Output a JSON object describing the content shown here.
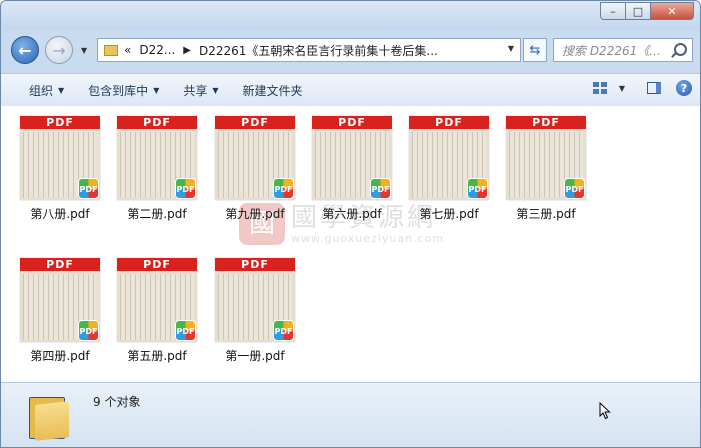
{
  "titlebar": {
    "minimize": "–",
    "maximize": "□",
    "close": "✕"
  },
  "nav": {
    "back_icon": "back-arrow-icon",
    "forward_icon": "forward-arrow-icon"
  },
  "address": {
    "overflow": "«",
    "crumb1": "D22...",
    "crumb2": "D22261《五朝宋名臣言行录前集十卷后集..."
  },
  "search": {
    "placeholder": "搜索 D22261《..."
  },
  "toolbar": {
    "organize": "组织",
    "include_library": "包含到库中",
    "share": "共享",
    "new_folder": "新建文件夹"
  },
  "files": [
    {
      "name": "第八册.pdf"
    },
    {
      "name": "第二册.pdf"
    },
    {
      "name": "第九册.pdf"
    },
    {
      "name": "第六册.pdf"
    },
    {
      "name": "第七册.pdf"
    },
    {
      "name": "第三册.pdf"
    },
    {
      "name": "第四册.pdf"
    },
    {
      "name": "第五册.pdf"
    },
    {
      "name": "第一册.pdf"
    }
  ],
  "thumb": {
    "header": "PDF",
    "badge": "PDF"
  },
  "watermark": {
    "seal": "國",
    "name": "國學資源網",
    "url": "www.guoxueziyuan.com"
  },
  "status": {
    "count": "9 个对象"
  },
  "colors": {
    "pdf_red": "#d9211e",
    "window_frame": "#c9dbef",
    "toolbar_text": "#1e395b"
  }
}
